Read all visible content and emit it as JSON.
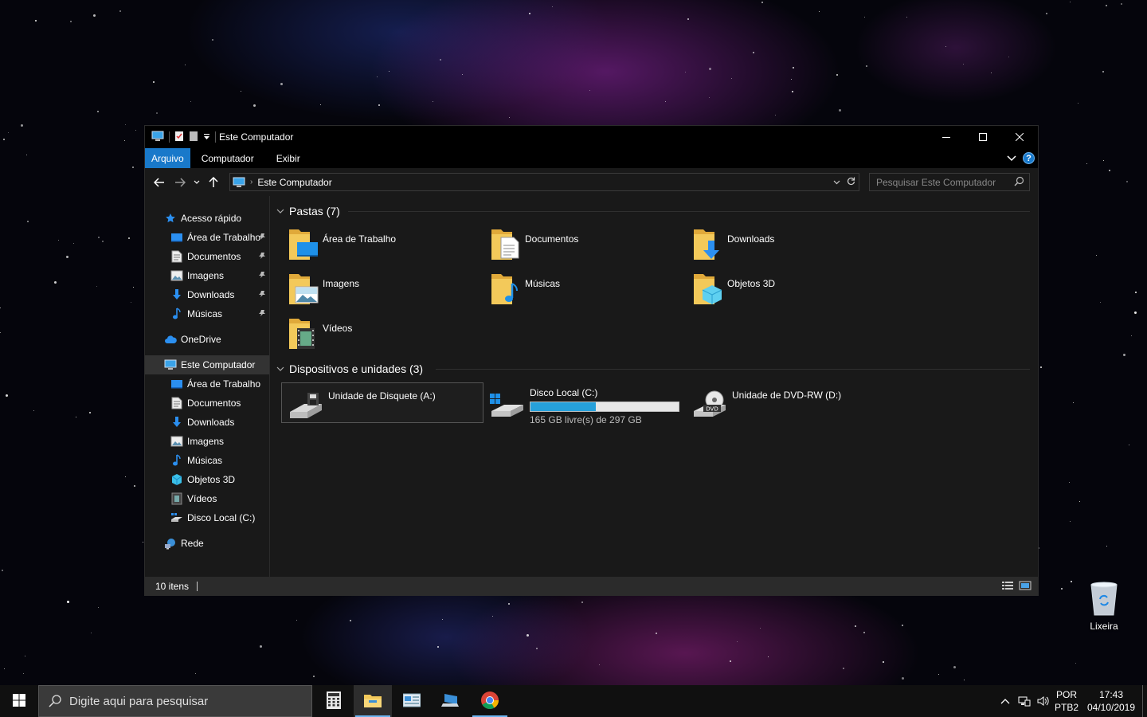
{
  "window": {
    "title": "Este Computador",
    "controls": {
      "minimize": "—",
      "maximize": "☐",
      "close": "✕"
    }
  },
  "ribbon": {
    "tabs": [
      {
        "label": "Arquivo",
        "active": true
      },
      {
        "label": "Computador",
        "active": false
      },
      {
        "label": "Exibir",
        "active": false
      }
    ],
    "help": "?"
  },
  "navigation": {
    "address": "Este Computador",
    "search_placeholder": "Pesquisar Este Computador"
  },
  "sidebar": {
    "quick_access": {
      "label": "Acesso rápido",
      "items": [
        {
          "label": "Área de Trabalho",
          "icon": "desktop-icon",
          "pinned": true
        },
        {
          "label": "Documentos",
          "icon": "documents-icon",
          "pinned": true
        },
        {
          "label": "Imagens",
          "icon": "pictures-icon",
          "pinned": true
        },
        {
          "label": "Downloads",
          "icon": "downloads-icon",
          "pinned": true
        },
        {
          "label": "Músicas",
          "icon": "music-icon",
          "pinned": true
        }
      ]
    },
    "onedrive": {
      "label": "OneDrive"
    },
    "this_pc": {
      "label": "Este Computador",
      "items": [
        {
          "label": "Área de Trabalho",
          "icon": "desktop-icon"
        },
        {
          "label": "Documentos",
          "icon": "documents-icon"
        },
        {
          "label": "Downloads",
          "icon": "downloads-icon"
        },
        {
          "label": "Imagens",
          "icon": "pictures-icon"
        },
        {
          "label": "Músicas",
          "icon": "music-icon"
        },
        {
          "label": "Objetos 3D",
          "icon": "3d-objects-icon"
        },
        {
          "label": "Vídeos",
          "icon": "videos-icon"
        },
        {
          "label": "Disco Local (C:)",
          "icon": "local-disk-icon"
        }
      ]
    },
    "network": {
      "label": "Rede"
    }
  },
  "content": {
    "folders_header": "Pastas (7)",
    "folders": [
      {
        "label": "Área de Trabalho",
        "icon": "desktop-folder-icon"
      },
      {
        "label": "Documentos",
        "icon": "documents-folder-icon"
      },
      {
        "label": "Downloads",
        "icon": "downloads-folder-icon"
      },
      {
        "label": "Imagens",
        "icon": "pictures-folder-icon"
      },
      {
        "label": "Músicas",
        "icon": "music-folder-icon"
      },
      {
        "label": "Objetos 3D",
        "icon": "3d-objects-folder-icon"
      },
      {
        "label": "Vídeos",
        "icon": "videos-folder-icon"
      }
    ],
    "devices_header": "Dispositivos e unidades (3)",
    "devices": [
      {
        "label": "Unidade de Disquete (A:)",
        "icon": "floppy-drive-icon",
        "selected": true
      },
      {
        "label": "Disco Local (C:)",
        "icon": "local-disk-icon",
        "space": "165 GB livre(s) de 297 GB",
        "used_fraction": 0.44
      },
      {
        "label": "Unidade de DVD-RW (D:)",
        "icon": "dvd-drive-icon"
      }
    ]
  },
  "status": {
    "items": "10 itens"
  },
  "desktop": {
    "recycle_bin": "Lixeira"
  },
  "taskbar": {
    "search_placeholder": "Digite aqui para pesquisar",
    "lang_top": "POR",
    "lang_bottom": "PTB2",
    "time": "17:43",
    "date": "04/10/2019"
  },
  "colors": {
    "accent": "#1979ca",
    "disk_fill": "#26a0da",
    "folder": "#f3c95a"
  }
}
